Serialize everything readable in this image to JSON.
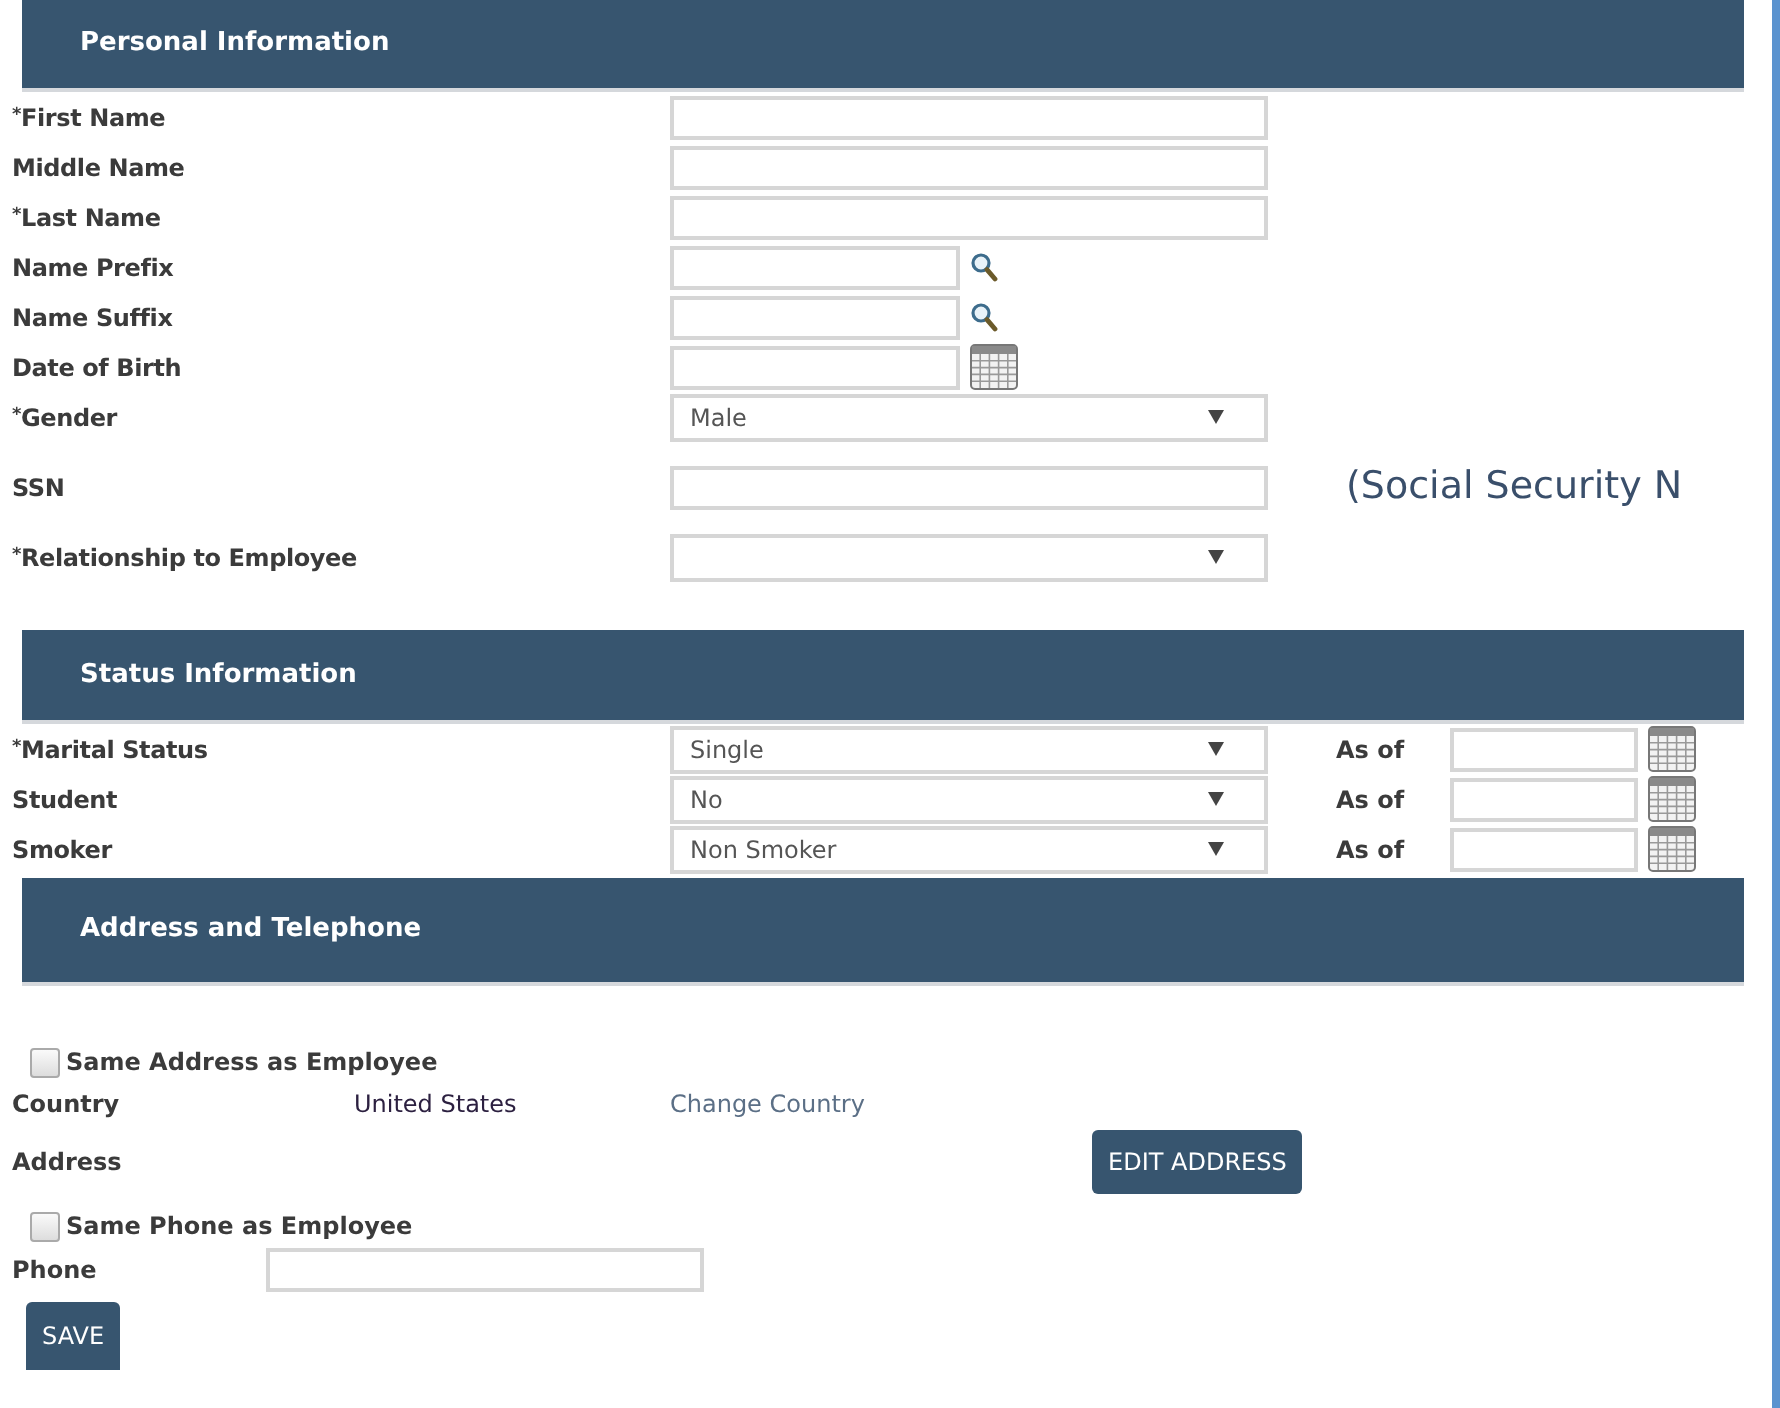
{
  "sections": [
    {
      "title": "Personal Information",
      "fields": [
        {
          "kind": "text",
          "label": "$^{*}$First Name"
        },
        {
          "kind": "text",
          "label": "Middle Name"
        },
        {
          "kind": "text",
          "label": "$^{*}$Last Name"
        },
        {
          "kind": "lookup",
          "label": "Name Prefix"
        },
        {
          "kind": "lookup",
          "label": "Name Suffix"
        },
        {
          "kind": "date",
          "label": "Date of Birth"
        },
        {
          "kind": "select",
          "label": "$^{*}$Gender",
          "value": "Male"
        },
        {
          "kind": "text",
          "label": "SSN",
          "note": "(Social Security N"
        },
        {
          "kind": "select",
          "label": "$^{*}$Relationship to Employee"
        }
      ]
    },
    {
      "title": "Status Information",
      "fields": [
        {
          "kind": "select",
          "label": "$^{*}$Marital Status",
          "value": "Single",
          "as_of": "As of"
        },
        {
          "kind": "select",
          "label": "Student",
          "value": "No",
          "as_of": "As of"
        },
        {
          "kind": "select",
          "label": "Smoker",
          "value": "Non Smoker",
          "as_of": "As of"
        }
      ]
    },
    {
      "title": "Address and Telephone",
      "fields": [
        {
          "kind": "checkbox",
          "label": "Same Address as Employee",
          "checked": false
        },
        {
          "kind": "info",
          "label": "Country",
          "value": "United States",
          "link": "Change Country"
        },
        {
          "kind": "button",
          "label": "Address",
          "button": "EDIT ADDRESS"
        },
        {
          "kind": "checkbox",
          "label": "Same Phone as Employee",
          "checked": false
        },
        {
          "kind": "phone",
          "label": "Phone"
        }
      ]
    }
  ],
  "save_button": "SAVE"
}
